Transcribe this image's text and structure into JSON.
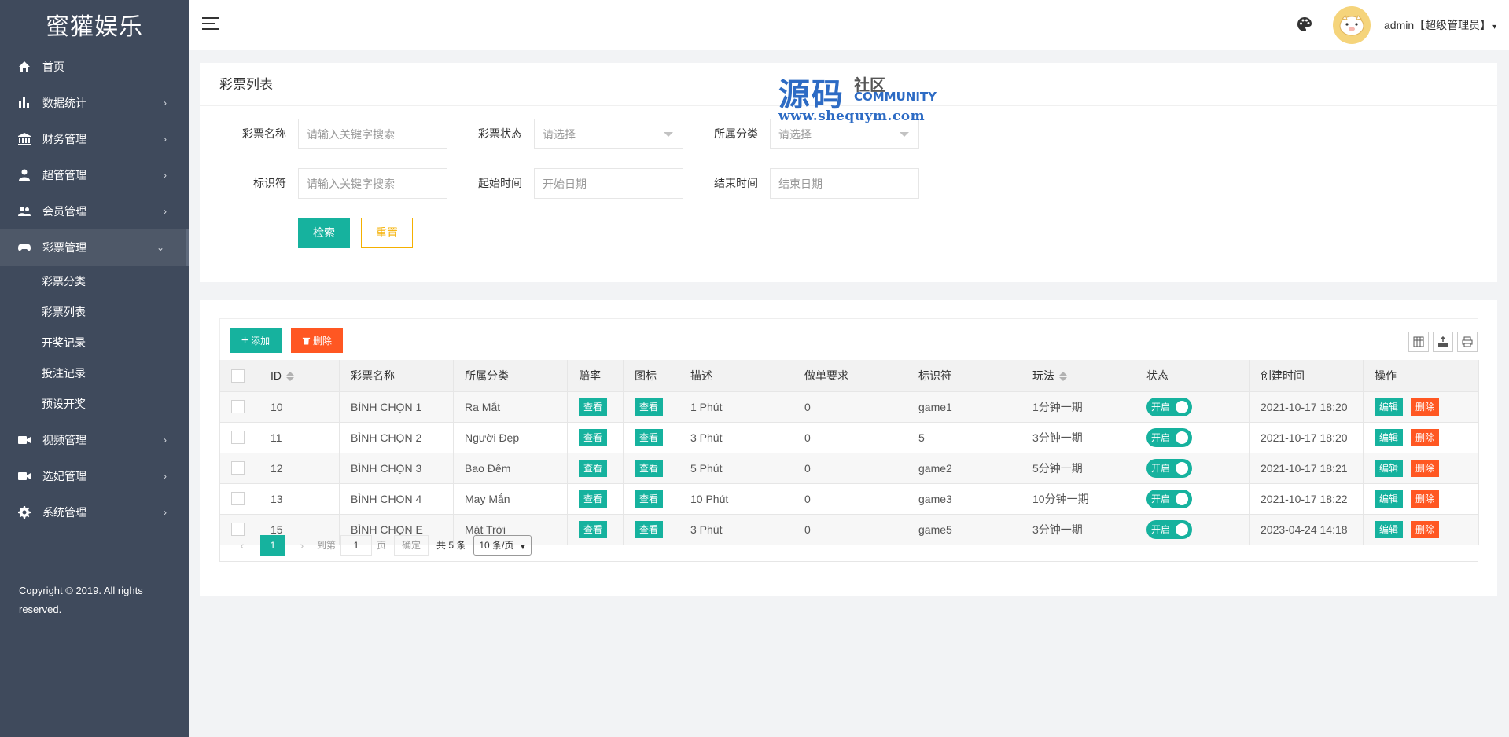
{
  "sidebar": {
    "logo": "蜜獾娱乐",
    "items": [
      {
        "label": "首页",
        "icon": "home-icon",
        "arrow": ""
      },
      {
        "label": "数据统计",
        "icon": "bar-chart-icon",
        "arrow": "›"
      },
      {
        "label": "财务管理",
        "icon": "bank-icon",
        "arrow": "›"
      },
      {
        "label": "超管管理",
        "icon": "user-icon",
        "arrow": "›"
      },
      {
        "label": "会员管理",
        "icon": "users-icon",
        "arrow": "›"
      },
      {
        "label": "彩票管理",
        "icon": "gamepad-icon",
        "arrow": "⌄"
      },
      {
        "label": "视频管理",
        "icon": "video-icon",
        "arrow": "›"
      },
      {
        "label": "选妃管理",
        "icon": "video-icon",
        "arrow": "›"
      },
      {
        "label": "系统管理",
        "icon": "gear-icon",
        "arrow": "›"
      }
    ],
    "sub_items": [
      "彩票分类",
      "彩票列表",
      "开奖记录",
      "投注记录",
      "预设开奖"
    ],
    "copyright": "Copyright © 2019. All rights reserved."
  },
  "header": {
    "user": "admin【超级管理员】",
    "caret": "▾"
  },
  "watermark": {
    "big": "源码",
    "cn": "社区",
    "en": "COMMUNITY",
    "url": "www.shequym.com"
  },
  "filter": {
    "title": "彩票列表",
    "fields": [
      {
        "label": "彩票名称",
        "placeholder": "请输入关键字搜索"
      },
      {
        "label": "彩票状态",
        "placeholder": "请选择"
      },
      {
        "label": "所属分类",
        "placeholder": "请选择"
      },
      {
        "label": "标识符",
        "placeholder": "请输入关键字搜索"
      },
      {
        "label": "起始时间",
        "placeholder": "开始日期"
      },
      {
        "label": "结束时间",
        "placeholder": "结束日期"
      }
    ],
    "search_label": "检索",
    "reset_label": "重置"
  },
  "toolbar": {
    "add_label": "添加",
    "delete_label": "删除"
  },
  "table": {
    "columns": [
      "ID",
      "彩票名称",
      "所属分类",
      "赔率",
      "图标",
      "描述",
      "做单要求",
      "标识符",
      "玩法",
      "状态",
      "创建时间",
      "操作"
    ],
    "view_label": "查看",
    "switch_label": "开启",
    "edit_label": "编辑",
    "del_label": "删除",
    "rows": [
      {
        "id": "10",
        "name": "BÌNH CHỌN 1",
        "category": "Ra Mắt",
        "desc": "1 Phút",
        "req": "0",
        "code": "game1",
        "play": "1分钟一期",
        "created": "2021-10-17 18:20"
      },
      {
        "id": "11",
        "name": "BÌNH CHỌN 2",
        "category": "Người Đẹp",
        "desc": "3 Phút",
        "req": "0",
        "code": "5",
        "play": "3分钟一期",
        "created": "2021-10-17 18:20"
      },
      {
        "id": "12",
        "name": "BÌNH CHỌN 3",
        "category": "Bao Đêm",
        "desc": "5 Phút",
        "req": "0",
        "code": "game2",
        "play": "5分钟一期",
        "created": "2021-10-17 18:21"
      },
      {
        "id": "13",
        "name": "BÌNH CHỌN 4",
        "category": "May Mắn",
        "desc": "10 Phút",
        "req": "0",
        "code": "game3",
        "play": "10分钟一期",
        "created": "2021-10-17 18:22"
      },
      {
        "id": "15",
        "name": "BÌNH CHỌN E",
        "category": "Mặt Trời",
        "desc": "3 Phút",
        "req": "0",
        "code": "game5",
        "play": "3分钟一期",
        "created": "2023-04-24 14:18"
      }
    ]
  },
  "pager": {
    "prev": "‹",
    "current": "1",
    "next": "›",
    "goto_label": "到第",
    "goto_value": "1",
    "page_unit": "页",
    "ok_label": "确定",
    "total": "共 5 条",
    "size": "10 条/页"
  },
  "colors": {
    "sidebar": "#3f4a5c",
    "primary": "#16b29e",
    "danger": "#ff5722",
    "warning": "#f5b000"
  }
}
